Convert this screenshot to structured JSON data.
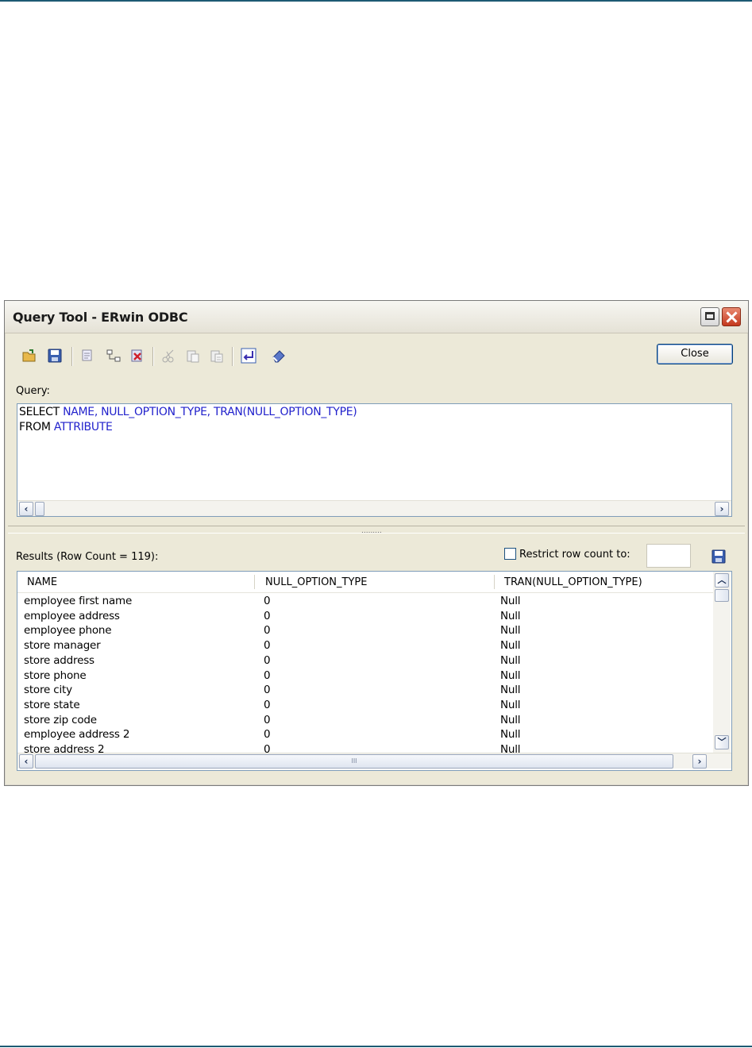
{
  "window": {
    "title": "Query Tool - ERwin ODBC",
    "close_button_label": "Close"
  },
  "toolbar": {
    "icons": [
      "open-folder-icon",
      "save-icon",
      "copy-query-icon",
      "link-icon",
      "delete-icon",
      "cut-icon",
      "paste-icon",
      "paste-special-icon",
      "execute-icon",
      "eraser-icon"
    ]
  },
  "query": {
    "label": "Query:",
    "line1_keyword": "SELECT",
    "line1_columns": "NAME, NULL_OPTION_TYPE, TRAN(NULL_OPTION_TYPE)",
    "line2_keyword": "FROM",
    "line2_table": "ATTRIBUTE"
  },
  "splitter": {
    "grip": "........."
  },
  "results": {
    "label": "Results (Row Count = 119):",
    "restrict_label": "Restrict row count to:",
    "restrict_checked": false,
    "restrict_value": "",
    "columns": [
      "NAME",
      "NULL_OPTION_TYPE",
      "TRAN(NULL_OPTION_TYPE)"
    ],
    "rows": [
      [
        "employee first name",
        "0",
        "Null"
      ],
      [
        "employee address",
        "0",
        "Null"
      ],
      [
        "employee phone",
        "0",
        "Null"
      ],
      [
        "store manager",
        "0",
        "Null"
      ],
      [
        "store address",
        "0",
        "Null"
      ],
      [
        "store phone",
        "0",
        "Null"
      ],
      [
        "store city",
        "0",
        "Null"
      ],
      [
        "store state",
        "0",
        "Null"
      ],
      [
        "store zip code",
        "0",
        "Null"
      ],
      [
        "employee address 2",
        "0",
        "Null"
      ],
      [
        "store address 2",
        "0",
        "Null"
      ]
    ],
    "hscroll_grip": "III"
  },
  "colors": {
    "window_bg": "#ece9d8",
    "query_identifier": "#2222cc",
    "border_blue": "#7f9db9",
    "page_rule": "#1d5a73"
  }
}
